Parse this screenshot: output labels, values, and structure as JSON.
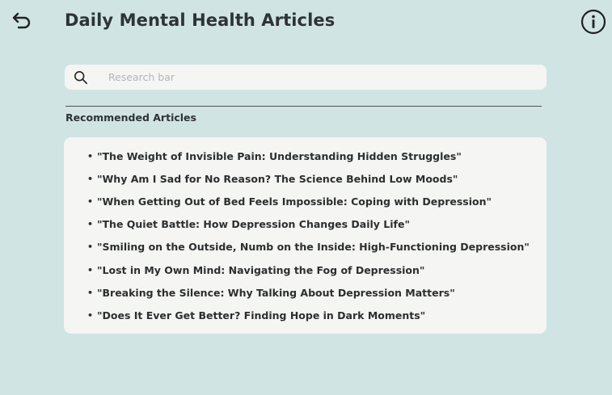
{
  "header": {
    "title": "Daily Mental Health Articles",
    "back_icon": "undo-arrow-icon",
    "info_icon": "info-circle-icon"
  },
  "search": {
    "placeholder": "Research bar",
    "value": "",
    "icon": "search-icon"
  },
  "recommended": {
    "heading": "Recommended Articles",
    "bullet": "•",
    "articles": [
      "\"The Weight of Invisible Pain: Understanding Hidden Struggles\"",
      "\"Why Am I Sad for No Reason? The Science Behind Low Moods\"",
      "\"When Getting Out of Bed Feels Impossible: Coping with Depression\"",
      "\"The Quiet Battle: How Depression Changes Daily Life\"",
      "\"Smiling on the Outside, Numb on the Inside: High-Functioning Depression\"",
      "\"Lost in My Own Mind: Navigating the Fog of Depression\"",
      "\"Breaking the Silence: Why Talking About Depression Matters\"",
      "\"Does It Ever Get Better? Finding Hope in Dark Moments\""
    ]
  },
  "colors": {
    "background": "#d0e4e3",
    "card": "#f5f5f3",
    "text": "#2b2f30",
    "placeholder": "#b3b6b7"
  }
}
